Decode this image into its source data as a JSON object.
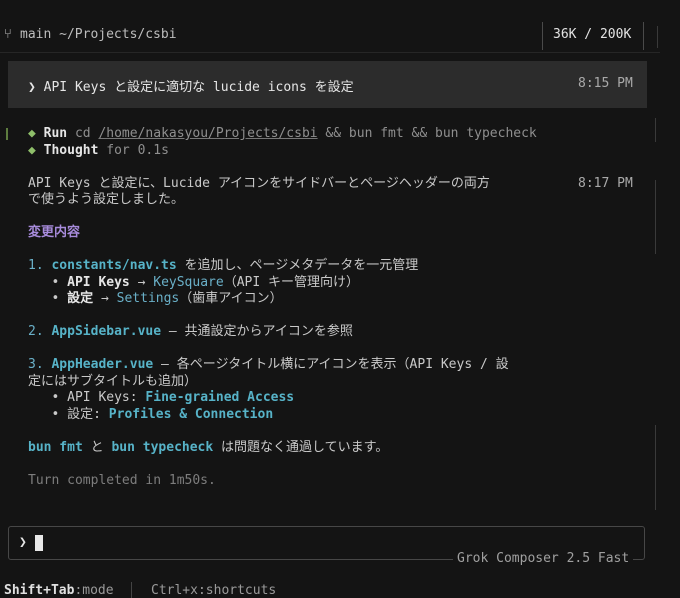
{
  "topbar": {
    "branch_icon": "git-branch-icon",
    "branch_text": "main ~/Projects/csbi",
    "tokens": "36K / 200K"
  },
  "prompt": {
    "text": "❯ API Keys と設定に適切な lucide icons を設定",
    "time": "8:15 PM"
  },
  "run": {
    "label": "Run",
    "cmd_prefix": "cd ",
    "path": "/home/nakasyou/Projects/csbi",
    "cmd_suffix": " && bun fmt && bun typecheck",
    "diamond": "◆"
  },
  "thought": {
    "label": "Thought",
    "duration": "for 0.1s"
  },
  "response": {
    "intro_line1": "API Keys と設定に、Lucide アイコンをサイドバーとページヘッダーの両方",
    "intro_line2": "で使うよう設定しました。",
    "time": "8:17 PM",
    "heading": "変更内容",
    "item1": {
      "num": "1.",
      "file": "constants/nav.ts",
      "desc": " を追加し、ページメタデータを一元管理",
      "sub1_label": "API Keys",
      "sub1_arrow": " → ",
      "sub1_value": "KeySquare",
      "sub1_note": "（API キー管理向け）",
      "sub2_label": "設定",
      "sub2_arrow": " → ",
      "sub2_value": "Settings",
      "sub2_note": "（歯車アイコン）"
    },
    "item2": {
      "num": "2.",
      "file": "AppSidebar.vue",
      "desc": " — 共通設定からアイコンを参照"
    },
    "item3": {
      "num": "3.",
      "file": "AppHeader.vue",
      "desc_line1": " — 各ページタイトル横にアイコンを表示（API Keys / 設",
      "desc_line2": "定にはサブタイトルも追加）",
      "sub1_label": "API Keys: ",
      "sub1_value": "Fine-grained Access",
      "sub2_label": "設定: ",
      "sub2_value": "Profiles & Connection"
    },
    "summary": {
      "cmd1": "bun fmt",
      "and": " と ",
      "cmd2": "bun typecheck",
      "rest": " は問題なく通過しています。"
    },
    "turn": "Turn completed in 1m50s."
  },
  "input": {
    "prompt_symbol": "❯",
    "model": "Grok Composer 2.5 Fast"
  },
  "footer": {
    "key1": "Shift+Tab",
    "desc1": ":mode",
    "key2": "Ctrl+x",
    "desc2": ":shortcuts"
  },
  "colors": {
    "background": "#141414",
    "accent_green": "#8fbf6a",
    "accent_cyan": "#57b3c8",
    "accent_purple": "#a78bdb",
    "prompt_bg": "#2c2c2c"
  }
}
